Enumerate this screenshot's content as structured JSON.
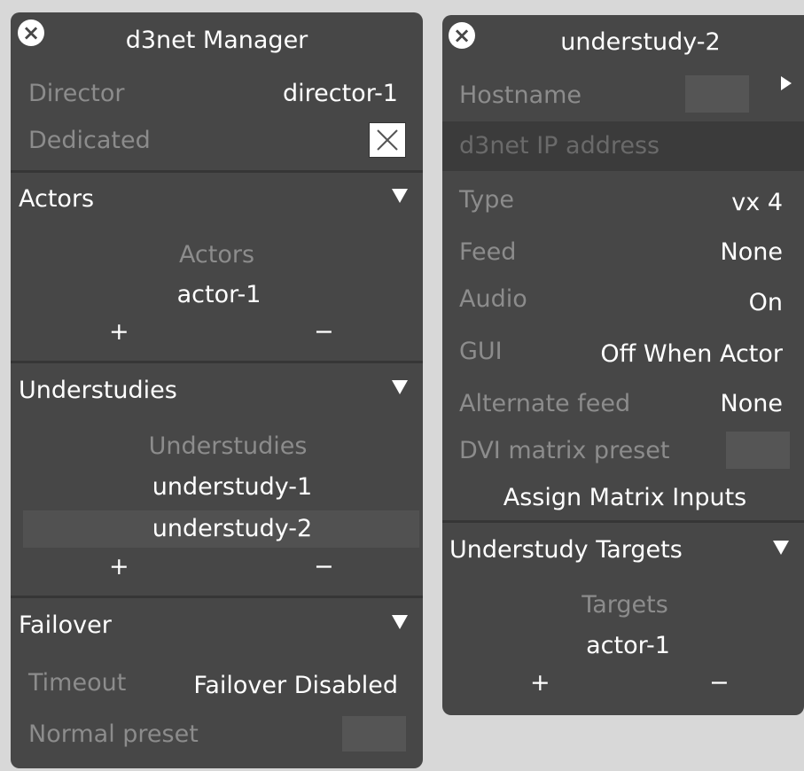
{
  "manager": {
    "title": "d3net Manager",
    "director_label": "Director",
    "director_value": "director-1",
    "dedicated_label": "Dedicated",
    "actors": {
      "header": "Actors",
      "list_title": "Actors",
      "items": [
        "actor-1"
      ],
      "add": "+",
      "remove": "−"
    },
    "understudies": {
      "header": "Understudies",
      "list_title": "Understudies",
      "items": [
        "understudy-1",
        "understudy-2"
      ],
      "add": "+",
      "remove": "−"
    },
    "failover": {
      "header": "Failover",
      "timeout_label": "Timeout",
      "timeout_value": "Failover Disabled",
      "normal_preset_label": "Normal preset"
    }
  },
  "understudy_panel": {
    "title": "understudy-2",
    "hostname_label": "Hostname",
    "ip_placeholder": "d3net IP address",
    "type_label": "Type",
    "type_value": "vx 4",
    "feed_label": "Feed",
    "feed_value": "None",
    "audio_label": "Audio",
    "audio_value": "On",
    "gui_label": "GUI",
    "gui_value": "Off When Actor",
    "alt_feed_label": "Alternate feed",
    "alt_feed_value": "None",
    "dvi_label": "DVI matrix preset",
    "assign_button": "Assign Matrix Inputs",
    "targets": {
      "header": "Understudy Targets",
      "list_title": "Targets",
      "items": [
        "actor-1"
      ],
      "add": "+",
      "remove": "−"
    }
  },
  "icons": {
    "close": "close-icon",
    "collapse": "triangle-down-icon",
    "expand": "triangle-right-icon"
  },
  "colors": {
    "background": "#d8d8d8",
    "panel": "#474747",
    "separator": "#363636",
    "text": "#ffffff",
    "label_dim": "#8c8c8c"
  }
}
